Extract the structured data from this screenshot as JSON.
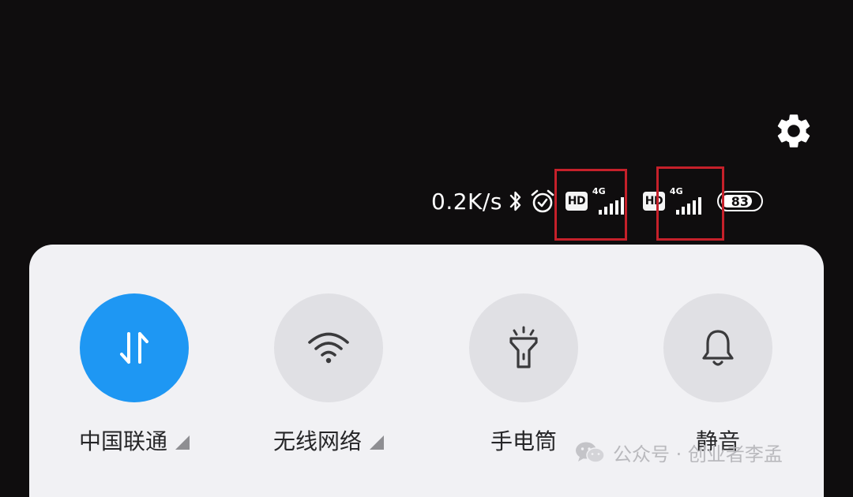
{
  "status_bar": {
    "net_speed": "0.2K/s",
    "hd_badge_1": "HD",
    "hd_badge_2": "HD",
    "network_1": "4G",
    "network_2": "4G",
    "battery_level": "83",
    "battery_fraction": 0.83,
    "icons": [
      "bluetooth-icon",
      "alarm-icon",
      "hd-icon",
      "signal-4g-icon",
      "hd-icon",
      "signal-4g-icon",
      "battery-icon"
    ]
  },
  "header": {
    "settings_icon": "gear-icon"
  },
  "quick_tiles": [
    {
      "label": "中国联通",
      "icon": "mobile-data-icon",
      "active": true,
      "has_expand": true
    },
    {
      "label": "无线网络",
      "icon": "wifi-icon",
      "active": false,
      "has_expand": true
    },
    {
      "label": "手电筒",
      "icon": "flashlight-icon",
      "active": false,
      "has_expand": false
    },
    {
      "label": "静音",
      "icon": "bell-icon",
      "active": false,
      "has_expand": false
    }
  ],
  "watermark": {
    "text": "公众号 · 创业者李孟"
  },
  "colors": {
    "background": "#0f0d0e",
    "panel": "#f1f1f4",
    "tile_inactive": "#e0e0e4",
    "tile_active": "#1e97f3",
    "highlight_box": "#c5202a"
  }
}
